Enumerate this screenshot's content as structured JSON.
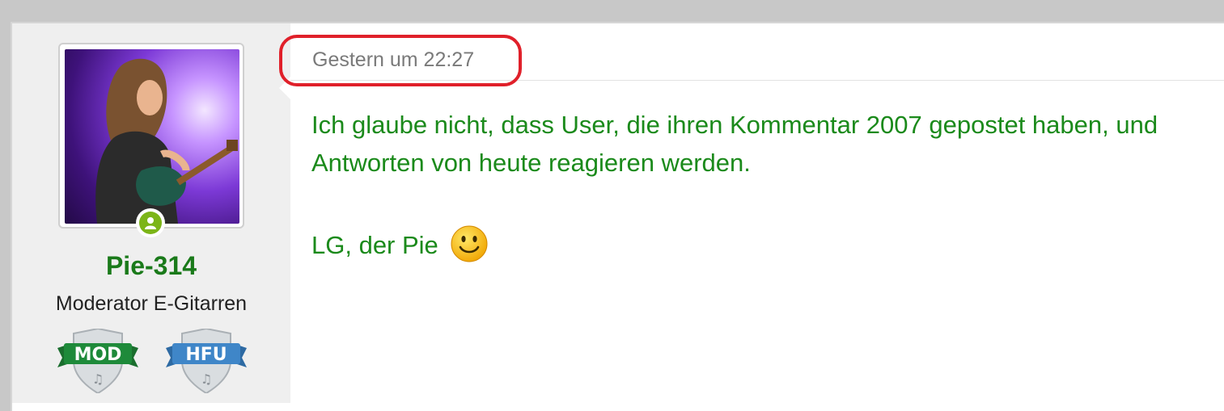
{
  "user": {
    "name": "Pie-314",
    "title": "Moderator E-Gitarren",
    "status": "online",
    "badges": [
      {
        "label": "MOD",
        "color": "#1e8a3a"
      },
      {
        "label": "HFU",
        "color": "#3f86c8"
      }
    ]
  },
  "post": {
    "timestamp": "Gestern um 22:27",
    "message_line1": "Ich glaube nicht, dass User, die ihren Kommentar 2007 gepostet haben, und",
    "message_line2": "Antworten von heute reagieren werden.",
    "signoff": "LG, der Pie",
    "emoji": "smiley-icon"
  },
  "colors": {
    "highlight": "#e0202a",
    "text_green": "#1b8a1b",
    "username_green": "#1a7a1a"
  }
}
